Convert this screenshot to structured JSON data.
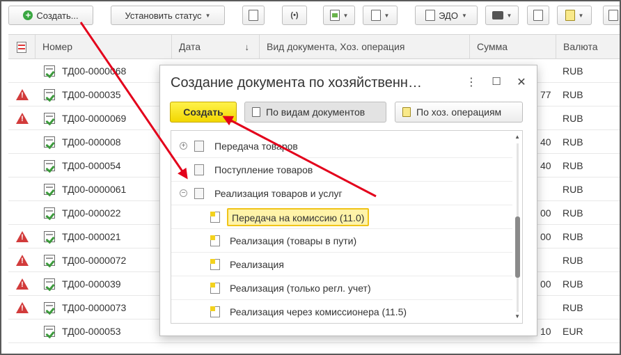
{
  "toolbar": {
    "create_label": "Создать...",
    "set_status_label": "Установить статус",
    "edo_label": "ЭДО"
  },
  "table": {
    "columns": [
      "Номер",
      "Дата",
      "Вид документа, Хоз. операция",
      "Сумма",
      "Валюта"
    ],
    "sort_indicator": "↓",
    "rows": [
      {
        "warning": false,
        "number": "ТД00-0000068",
        "sum": "",
        "currency": "RUB"
      },
      {
        "warning": true,
        "number": "ТД00-000035",
        "sum": "77",
        "currency": "RUB"
      },
      {
        "warning": true,
        "number": "ТД00-0000069",
        "sum": "",
        "currency": "RUB"
      },
      {
        "warning": false,
        "number": "ТД00-000008",
        "sum": "40",
        "currency": "RUB"
      },
      {
        "warning": false,
        "number": "ТД00-000054",
        "sum": "40",
        "currency": "RUB"
      },
      {
        "warning": false,
        "number": "ТД00-0000061",
        "sum": "",
        "currency": "RUB"
      },
      {
        "warning": false,
        "number": "ТД00-000022",
        "sum": "00",
        "currency": "RUB"
      },
      {
        "warning": true,
        "number": "ТД00-000021",
        "sum": "00",
        "currency": "RUB"
      },
      {
        "warning": true,
        "number": "ТД00-0000072",
        "sum": "",
        "currency": "RUB"
      },
      {
        "warning": true,
        "number": "ТД00-000039",
        "sum": "00",
        "currency": "RUB"
      },
      {
        "warning": true,
        "number": "ТД00-0000073",
        "sum": "",
        "currency": "RUB"
      },
      {
        "warning": false,
        "number": "ТД00-000053",
        "sum": "10",
        "currency": "EUR"
      }
    ]
  },
  "dialog": {
    "title": "Создание документа по хозяйственн…",
    "more_icon": "⋮",
    "maximize_icon": "☐",
    "close_icon": "✕",
    "create_label": "Создать",
    "by_doc_types_label": "По видам документов",
    "by_operations_label": "По хоз. операциям",
    "tree": [
      {
        "level": 0,
        "expander": "plus",
        "label": "Передача товаров"
      },
      {
        "level": 0,
        "expander": "none",
        "label": "Поступление товаров"
      },
      {
        "level": 0,
        "expander": "minus",
        "label": "Реализация товаров и услуг"
      },
      {
        "level": 1,
        "expander": "none",
        "label": "Передача на комиссию (11.0)",
        "selected": true
      },
      {
        "level": 1,
        "expander": "none",
        "label": "Реализация (товары в пути)"
      },
      {
        "level": 1,
        "expander": "none",
        "label": "Реализация"
      },
      {
        "level": 1,
        "expander": "none",
        "label": "Реализация (только регл. учет)"
      },
      {
        "level": 1,
        "expander": "none",
        "label": "Реализация через комиссионера (11.5)"
      }
    ]
  },
  "colors": {
    "accent_yellow": "#f2d700",
    "warning_red": "#d23b3b",
    "annotation_red": "#e3001b"
  }
}
